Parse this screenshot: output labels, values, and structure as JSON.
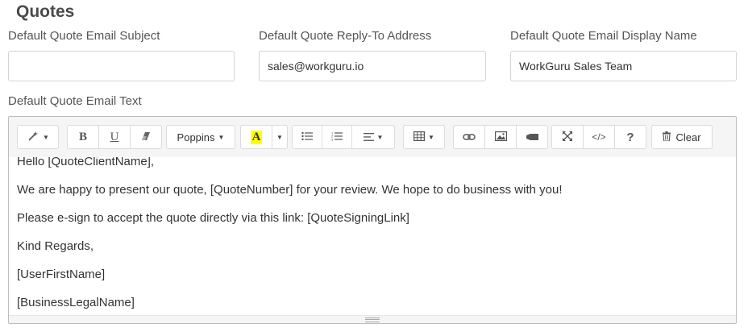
{
  "section": {
    "title": "Quotes"
  },
  "fields": {
    "subject": {
      "label": "Default Quote Email Subject",
      "value": ""
    },
    "reply_to": {
      "label": "Default Quote Reply-To Address",
      "value": "sales@workguru.io"
    },
    "display_name": {
      "label": "Default Quote Email Display Name",
      "value": "WorkGuru Sales Team"
    }
  },
  "editor": {
    "label": "Default Quote Email Text",
    "toolbar": {
      "style_icon": "magic-wand-icon",
      "bold": "B",
      "underline": "U",
      "eraser_icon": "eraser-icon",
      "font_name": "Poppins",
      "color_letter": "A",
      "highlight_color": "#ffff00",
      "unordered_icon": "list-ul-icon",
      "ordered_icon": "list-ol-icon",
      "align_icon": "align-left-icon",
      "table_icon": "table-icon",
      "link_icon": "link-icon",
      "picture_icon": "picture-icon",
      "video_icon": "video-icon",
      "fullscreen_icon": "expand-icon",
      "code_icon": "</>",
      "help_icon": "?",
      "clear_label": "Clear"
    },
    "lines": [
      "Hello [QuoteClientName],",
      "We are happy to present our quote, [QuoteNumber] for your review. We hope to do business with you!",
      "Please e-sign to accept the quote directly via this link: [QuoteSigningLink]",
      "Kind Regards,",
      "[UserFirstName]",
      "[BusinessLegalName]"
    ]
  }
}
